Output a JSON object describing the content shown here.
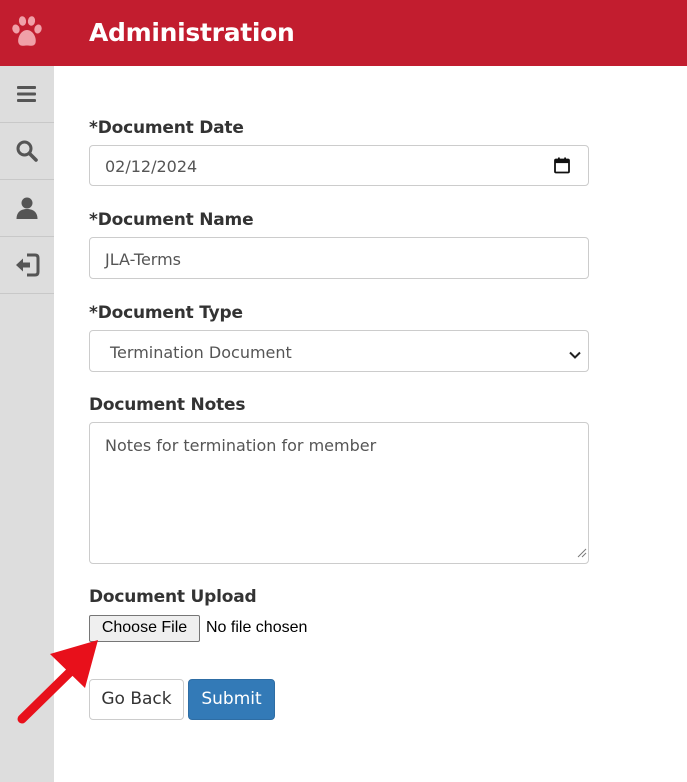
{
  "header": {
    "title": "Administration",
    "logo_icon": "paw-icon",
    "background_color": "#c21d2f"
  },
  "sidebar": {
    "items": [
      {
        "icon": "menu-icon"
      },
      {
        "icon": "search-icon"
      },
      {
        "icon": "user-icon"
      },
      {
        "icon": "logout-icon"
      }
    ]
  },
  "form": {
    "document_date": {
      "label": "*Document Date",
      "value": "02/12/2024",
      "icon": "calendar-icon"
    },
    "document_name": {
      "label": "*Document Name",
      "value": "JLA-Terms"
    },
    "document_type": {
      "label": "*Document Type",
      "selected": "Termination Document",
      "icon": "chevron-down-icon"
    },
    "document_notes": {
      "label": "Document Notes",
      "value": "Notes for termination for member"
    },
    "document_upload": {
      "label": "Document Upload",
      "button_label": "Choose File",
      "status": "No file chosen"
    }
  },
  "actions": {
    "back_label": "Go Back",
    "submit_label": "Submit",
    "submit_color": "#337ab7"
  },
  "annotation": {
    "arrow_color": "#e8101b",
    "arrow_icon": "red-arrow-icon"
  }
}
